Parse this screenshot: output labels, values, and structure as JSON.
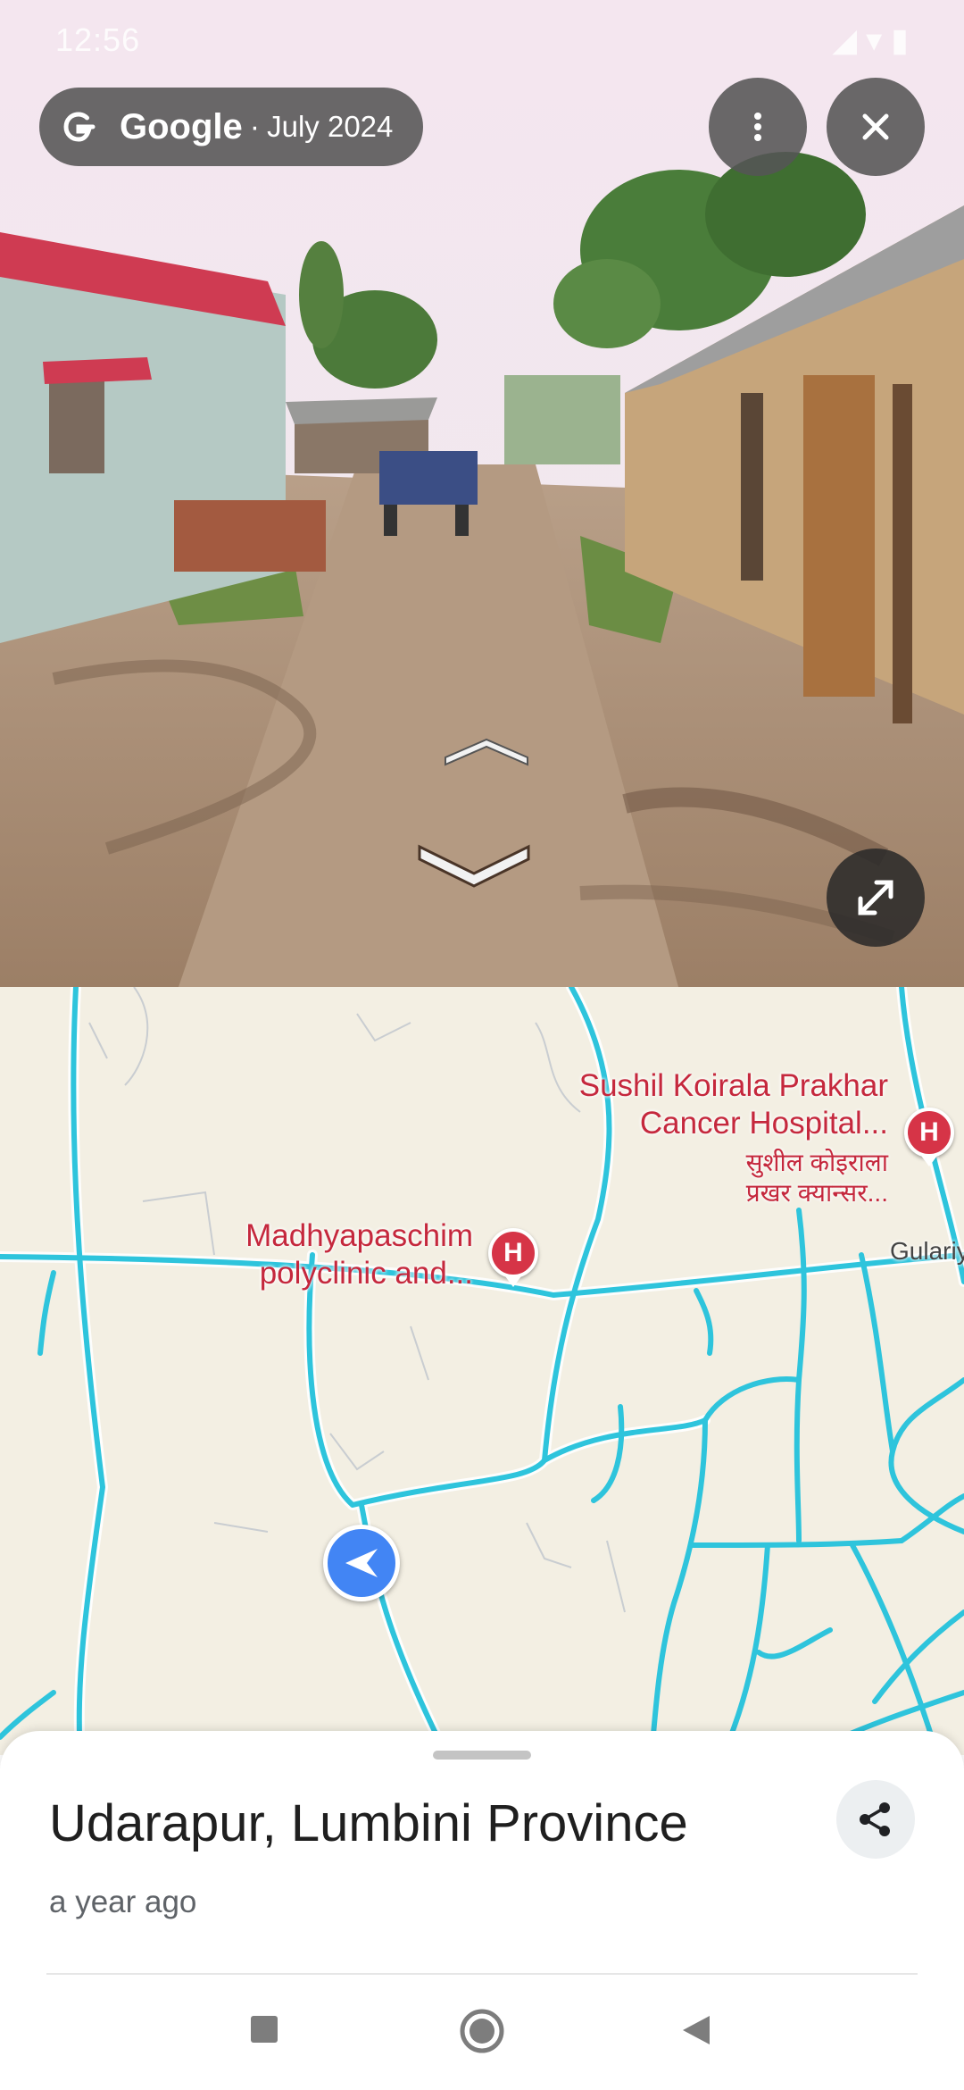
{
  "status_bar": {
    "time": "12:56",
    "icons": "◢ ▾ ▮"
  },
  "attribution": {
    "brand": "Google",
    "separator": "·",
    "date": "July 2024"
  },
  "map": {
    "pois": [
      {
        "name_line1": "Sushil Koirala Prakhar",
        "name_line2": "Cancer Hospital...",
        "local_line1": "सुशील कोइराला",
        "local_line2": "प्रखर क्यान्सर..."
      },
      {
        "name_line1": "Madhyapaschim",
        "name_line2": "polyclinic and..."
      }
    ],
    "road_label": "Gulariy",
    "pin_letter": "H",
    "road_color": "#2ec4dc",
    "poi_color": "#c5283d"
  },
  "sheet": {
    "title": "Udarapur, Lumbini Province",
    "subtitle": "a year ago"
  },
  "icons": {
    "more": "more-vert-icon",
    "close": "close-icon",
    "fullscreen": "fullscreen-icon",
    "share": "share-icon",
    "location": "navigation-arrow-icon"
  }
}
